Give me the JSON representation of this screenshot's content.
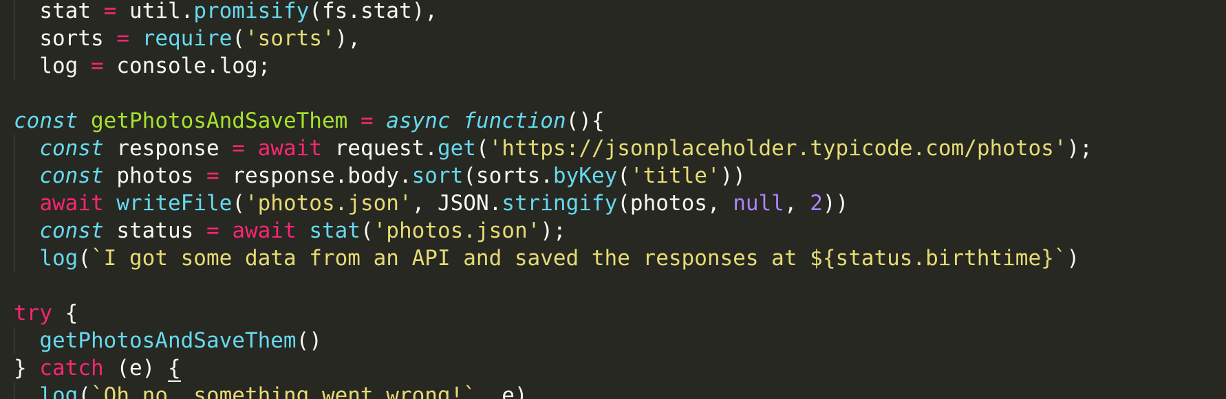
{
  "editor": {
    "theme_colors": {
      "background": "#272822",
      "foreground": "#f8f8f2",
      "keyword_control": "#f92672",
      "keyword_storage": "#66d9ef",
      "function_definition": "#a6e22e",
      "function_call": "#66d9ef",
      "string": "#e6db74",
      "constant": "#ae81ff"
    }
  },
  "lines": [
    {
      "indent_guide": true,
      "tokens": [
        {
          "t": "  ",
          "c": "ws"
        },
        {
          "t": "stat",
          "c": "plain"
        },
        {
          "t": " ",
          "c": "ws"
        },
        {
          "t": "=",
          "c": "op"
        },
        {
          "t": " util.",
          "c": "plain"
        },
        {
          "t": "promisify",
          "c": "fn-call"
        },
        {
          "t": "(fs.stat),",
          "c": "plain"
        }
      ]
    },
    {
      "indent_guide": true,
      "tokens": [
        {
          "t": "  ",
          "c": "ws"
        },
        {
          "t": "sorts",
          "c": "plain"
        },
        {
          "t": " ",
          "c": "ws"
        },
        {
          "t": "=",
          "c": "op"
        },
        {
          "t": " ",
          "c": "ws"
        },
        {
          "t": "require",
          "c": "fn-call"
        },
        {
          "t": "(",
          "c": "plain"
        },
        {
          "t": "'sorts'",
          "c": "str"
        },
        {
          "t": "),",
          "c": "plain"
        }
      ]
    },
    {
      "indent_guide": true,
      "tokens": [
        {
          "t": "  ",
          "c": "ws"
        },
        {
          "t": "log",
          "c": "plain"
        },
        {
          "t": " ",
          "c": "ws"
        },
        {
          "t": "=",
          "c": "op"
        },
        {
          "t": " console.log;",
          "c": "plain"
        }
      ]
    },
    {
      "indent_guide": false,
      "tokens": []
    },
    {
      "indent_guide": false,
      "tokens": [
        {
          "t": "const",
          "c": "kw-store"
        },
        {
          "t": " ",
          "c": "ws"
        },
        {
          "t": "getPhotosAndSaveThem",
          "c": "fn-def"
        },
        {
          "t": " ",
          "c": "ws"
        },
        {
          "t": "=",
          "c": "op"
        },
        {
          "t": " ",
          "c": "ws"
        },
        {
          "t": "async",
          "c": "kw-store"
        },
        {
          "t": " ",
          "c": "ws"
        },
        {
          "t": "function",
          "c": "kw-store"
        },
        {
          "t": "(){",
          "c": "plain"
        }
      ]
    },
    {
      "indent_guide": true,
      "tokens": [
        {
          "t": "  ",
          "c": "ws"
        },
        {
          "t": "const",
          "c": "kw-store"
        },
        {
          "t": " response ",
          "c": "plain"
        },
        {
          "t": "=",
          "c": "op"
        },
        {
          "t": " ",
          "c": "ws"
        },
        {
          "t": "await",
          "c": "kw-ctrl"
        },
        {
          "t": " request.",
          "c": "plain"
        },
        {
          "t": "get",
          "c": "fn-call"
        },
        {
          "t": "(",
          "c": "plain"
        },
        {
          "t": "'https://jsonplaceholder.typicode.com/photos'",
          "c": "str"
        },
        {
          "t": ");",
          "c": "plain"
        }
      ]
    },
    {
      "indent_guide": true,
      "tokens": [
        {
          "t": "  ",
          "c": "ws"
        },
        {
          "t": "const",
          "c": "kw-store"
        },
        {
          "t": " photos ",
          "c": "plain"
        },
        {
          "t": "=",
          "c": "op"
        },
        {
          "t": " response.body.",
          "c": "plain"
        },
        {
          "t": "sort",
          "c": "fn-call"
        },
        {
          "t": "(sorts.",
          "c": "plain"
        },
        {
          "t": "byKey",
          "c": "fn-call"
        },
        {
          "t": "(",
          "c": "plain"
        },
        {
          "t": "'title'",
          "c": "str"
        },
        {
          "t": "))",
          "c": "plain"
        }
      ]
    },
    {
      "indent_guide": true,
      "tokens": [
        {
          "t": "  ",
          "c": "ws"
        },
        {
          "t": "await",
          "c": "kw-ctrl"
        },
        {
          "t": " ",
          "c": "ws"
        },
        {
          "t": "writeFile",
          "c": "fn-call"
        },
        {
          "t": "(",
          "c": "plain"
        },
        {
          "t": "'photos.json'",
          "c": "str"
        },
        {
          "t": ", JSON.",
          "c": "plain"
        },
        {
          "t": "stringify",
          "c": "fn-call"
        },
        {
          "t": "(photos, ",
          "c": "plain"
        },
        {
          "t": "null",
          "c": "const"
        },
        {
          "t": ", ",
          "c": "plain"
        },
        {
          "t": "2",
          "c": "const"
        },
        {
          "t": "))",
          "c": "plain"
        }
      ]
    },
    {
      "indent_guide": true,
      "tokens": [
        {
          "t": "  ",
          "c": "ws"
        },
        {
          "t": "const",
          "c": "kw-store"
        },
        {
          "t": " status ",
          "c": "plain"
        },
        {
          "t": "=",
          "c": "op"
        },
        {
          "t": " ",
          "c": "ws"
        },
        {
          "t": "await",
          "c": "kw-ctrl"
        },
        {
          "t": " ",
          "c": "ws"
        },
        {
          "t": "stat",
          "c": "fn-call"
        },
        {
          "t": "(",
          "c": "plain"
        },
        {
          "t": "'photos.json'",
          "c": "str"
        },
        {
          "t": ");",
          "c": "plain"
        }
      ]
    },
    {
      "indent_guide": true,
      "tokens": [
        {
          "t": "  ",
          "c": "ws"
        },
        {
          "t": "log",
          "c": "fn-call"
        },
        {
          "t": "(",
          "c": "plain"
        },
        {
          "t": "`I got some data from an API and saved the responses at ${status.birthtime}`",
          "c": "str"
        },
        {
          "t": ")",
          "c": "plain"
        }
      ]
    },
    {
      "indent_guide": false,
      "tokens": []
    },
    {
      "indent_guide": false,
      "tokens": [
        {
          "t": "try",
          "c": "kw-ctrl"
        },
        {
          "t": " {",
          "c": "plain"
        }
      ]
    },
    {
      "indent_guide": true,
      "tokens": [
        {
          "t": "  ",
          "c": "ws"
        },
        {
          "t": "getPhotosAndSaveThem",
          "c": "fn-call"
        },
        {
          "t": "()",
          "c": "plain"
        }
      ]
    },
    {
      "indent_guide": false,
      "tokens": [
        {
          "t": "} ",
          "c": "plain"
        },
        {
          "t": "catch",
          "c": "kw-ctrl"
        },
        {
          "t": " (e) ",
          "c": "plain"
        },
        {
          "t": "{",
          "c": "plain bracket-match"
        }
      ]
    },
    {
      "indent_guide": true,
      "tokens": [
        {
          "t": "  ",
          "c": "ws"
        },
        {
          "t": "log",
          "c": "fn-call"
        },
        {
          "t": "(",
          "c": "plain"
        },
        {
          "t": "`Oh no, something went wrong!`",
          "c": "str"
        },
        {
          "t": ", e)",
          "c": "plain"
        }
      ]
    }
  ]
}
